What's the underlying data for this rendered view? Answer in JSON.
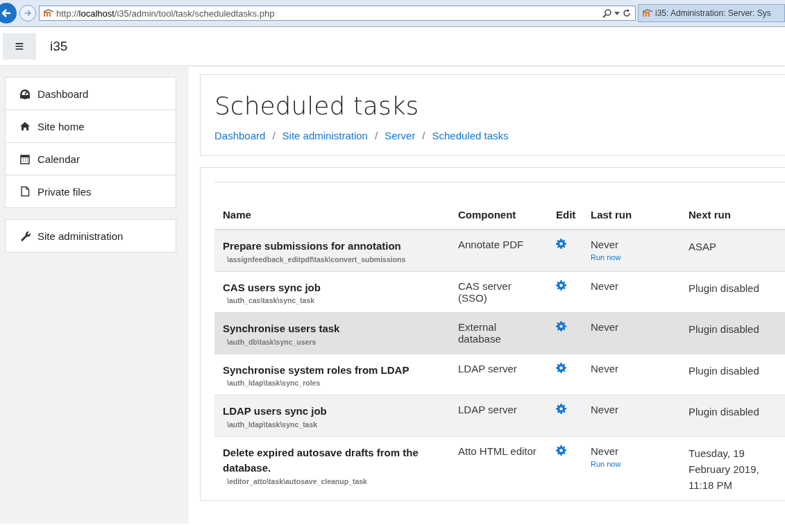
{
  "browser": {
    "url_prefix": "http://",
    "url_host": "localhost",
    "url_path": "/i35/admin/tool/task/scheduledtasks.php",
    "tab_title": "i35: Administration: Server: Sys"
  },
  "navbar": {
    "menu_glyph": "≡",
    "site_name": "i35"
  },
  "sidebar": {
    "groups": [
      {
        "items": [
          {
            "label": "Dashboard"
          },
          {
            "label": "Site home"
          },
          {
            "label": "Calendar"
          },
          {
            "label": "Private files"
          }
        ]
      },
      {
        "items": [
          {
            "label": "Site administration"
          }
        ]
      }
    ]
  },
  "page_header": {
    "title": "Scheduled tasks",
    "breadcrumbs": [
      "Dashboard",
      "Site administration",
      "Server",
      "Scheduled tasks"
    ],
    "separator": "/"
  },
  "table": {
    "columns": [
      "Name",
      "Component",
      "Edit",
      "Last run",
      "Next run"
    ],
    "rows": [
      {
        "name": "Prepare submissions for annotation",
        "classname": "\\assignfeedback_editpdf\\task\\convert_submissions",
        "component": "Annotate PDF",
        "last_run": "Never",
        "run_now": "Run now",
        "next_run": "ASAP",
        "hovered": false
      },
      {
        "name": "CAS users sync job",
        "classname": "\\auth_cas\\task\\sync_task",
        "component": "CAS server (SSO)",
        "last_run": "Never",
        "next_run": "Plugin disabled",
        "hovered": false
      },
      {
        "name": "Synchronise users task",
        "classname": "\\auth_db\\task\\sync_users",
        "component": "External database",
        "last_run": "Never",
        "next_run": "Plugin disabled",
        "hovered": true
      },
      {
        "name": "Synchronise system roles from LDAP",
        "classname": "\\auth_ldap\\task\\sync_roles",
        "component": "LDAP server",
        "last_run": "Never",
        "next_run": "Plugin disabled",
        "hovered": false
      },
      {
        "name": "LDAP users sync job",
        "classname": "\\auth_ldap\\task\\sync_task",
        "component": "LDAP server",
        "last_run": "Never",
        "next_run": "Plugin disabled",
        "hovered": false
      },
      {
        "name": "Delete expired autosave drafts from the database.",
        "classname": "\\editor_atto\\task\\autosave_cleanup_task",
        "component": "Atto HTML editor",
        "last_run": "Never",
        "run_now": "Run now",
        "next_run": "Tuesday, 19 February 2019, 11:18 PM",
        "hovered": false
      }
    ]
  }
}
